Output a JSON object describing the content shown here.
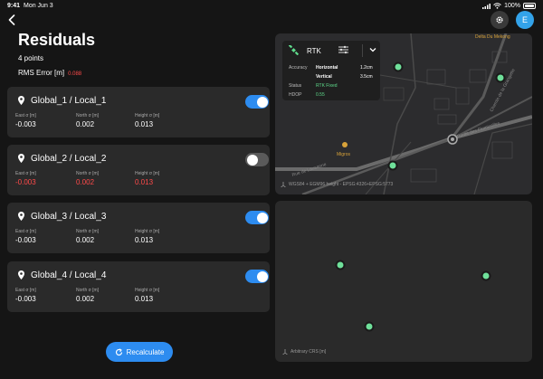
{
  "status_bar": {
    "time": "9:41",
    "date": "Mon Jun 3",
    "battery": "100%"
  },
  "header": {
    "avatar_initial": "E"
  },
  "page": {
    "title": "Residuals",
    "points_count": "4 points",
    "rms_label": "RMS Error [m]",
    "rms_value": "0.088"
  },
  "cards": [
    {
      "title": "Global_1 / Local_1",
      "enabled": true,
      "east_label": "East σ [m]",
      "north_label": "North σ [m]",
      "height_label": "Height σ [m]",
      "east": "-0.003",
      "north": "0.002",
      "height": "0.013"
    },
    {
      "title": "Global_2 / Local_2",
      "enabled": false,
      "east_label": "East σ [m]",
      "north_label": "North σ [m]",
      "height_label": "Height σ [m]",
      "east": "-0.003",
      "north": "0.002",
      "height": "0.013"
    },
    {
      "title": "Global_3 / Local_3",
      "enabled": true,
      "east_label": "East σ [m]",
      "north_label": "North σ [m]",
      "height_label": "Height σ [m]",
      "east": "-0.003",
      "north": "0.002",
      "height": "0.013"
    },
    {
      "title": "Global_4 / Local_4",
      "enabled": true,
      "east_label": "East σ [m]",
      "north_label": "North σ [m]",
      "height_label": "Height σ [m]",
      "east": "-0.003",
      "north": "0.002",
      "height": "0.013"
    }
  ],
  "recalculate_label": "Recalculate",
  "rtk": {
    "label": "RTK",
    "accuracy_label": "Accuracy",
    "horizontal_label": "Horizontal",
    "horizontal_value": "1.2cm",
    "vertical_label": "Vertical",
    "vertical_value": "3.5cm",
    "status_label": "Status",
    "status_value": "RTK Fixed",
    "hdop_label": "HDOP",
    "hdop_value": "0.55"
  },
  "map": {
    "poi_top": "Delta Du Mekong",
    "poi_mid": "Migros",
    "street_1": "Chemin de la Grangette",
    "street_2": "Route des Fluminelles",
    "street_3": "Rue de Lausanne",
    "footer": "WGS84 + EGM96 height - EPSG:4326+EPSG:5773"
  },
  "scatter": {
    "footer": "Arbitrary CRS [m]"
  },
  "colors": {
    "accent": "#2d8cf0",
    "error": "#ff4a4a",
    "point": "#6fe09a",
    "status_ok": "#5fdc8c"
  }
}
